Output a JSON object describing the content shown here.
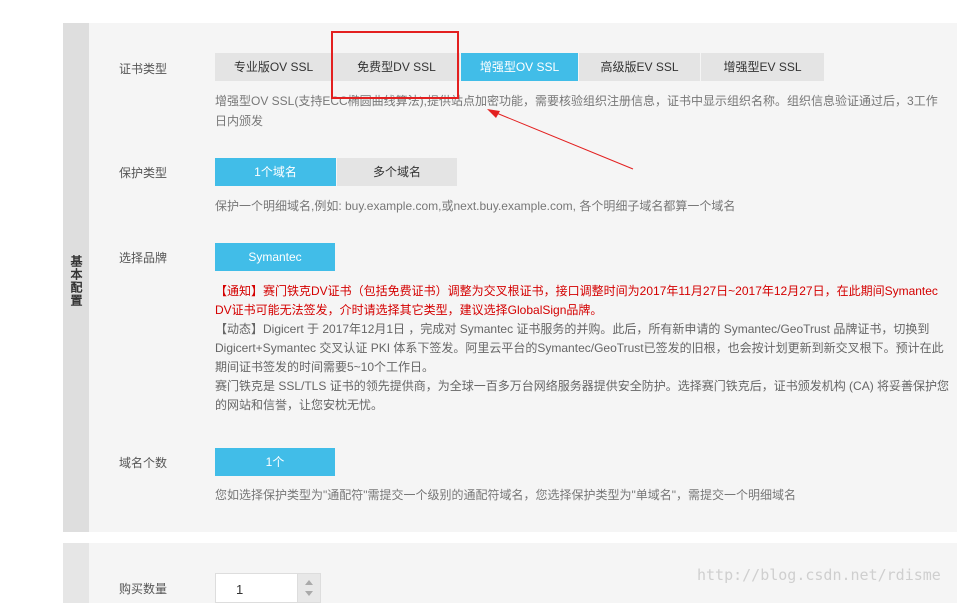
{
  "side_label": "基本配置",
  "cert_type": {
    "label": "证书类型",
    "options": [
      "专业版OV SSL",
      "免费型DV SSL",
      "增强型OV SSL",
      "高级版EV SSL",
      "增强型EV SSL"
    ],
    "selected": "增强型OV SSL",
    "desc_line1": "增强型OV SSL(支持ECC椭圆曲线算法),提供站点加密功能，需要核验组织注册信息，证书中显示组织名称。组织信息验证通过后，3工作",
    "desc_line2": "日内颁发"
  },
  "protect_type": {
    "label": "保护类型",
    "options": [
      "1个域名",
      "多个域名"
    ],
    "selected": "1个域名",
    "desc": "保护一个明细域名,例如: buy.example.com,或next.buy.example.com, 各个明细子域名都算一个域名"
  },
  "brand": {
    "label": "选择品牌",
    "option": "Symantec",
    "notice_red": "【通知】赛门铁克DV证书（包括免费证书）调整为交叉根证书，接口调整时间为2017年11月27日~2017年12月27日，在此期间Symantec DV证书可能无法签发，介时请选择其它类型，建议选择GlobalSign品牌。",
    "notice_dynamic": "【动态】Digicert 于 2017年12月1日 ，完成对 Symantec 证书服务的并购。此后，所有新申请的 Symantec/GeoTrust 品牌证书，切换到 Digicert+Symantec 交叉认证 PKI 体系下签发。阿里云平台的Symantec/GeoTrust已签发的旧根，也会按计划更新到新交叉根下。预计在此期间证书签发的时间需要5~10个工作日。",
    "notice_info": "赛门铁克是 SSL/TLS 证书的领先提供商，为全球一百多万台网络服务器提供安全防护。选择赛门铁克后，证书颁发机构 (CA) 将妥善保护您的网站和信誉，让您安枕无忧。"
  },
  "domain_count": {
    "label": "域名个数",
    "value": "1个",
    "desc": "您如选择保护类型为\"通配符\"需提交一个级别的通配符域名，您选择保护类型为\"单域名\"，需提交一个明细域名"
  },
  "purchase": {
    "label": "购买数量",
    "value": "1"
  },
  "watermark": "http://blog.csdn.net/rdisme",
  "colors": {
    "accent": "#41bde8",
    "annotation": "#e32020",
    "notice_red": "#d40000"
  }
}
